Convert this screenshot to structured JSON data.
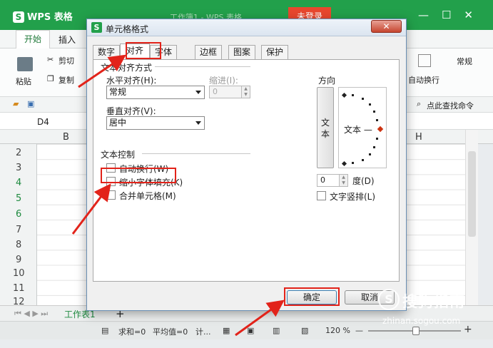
{
  "app": {
    "name": "WPS 表格",
    "doc_title": "工作簿1 - WPS 表格",
    "login_label": "未登录",
    "window_controls": [
      "—",
      "☐",
      "✕"
    ]
  },
  "ribbon": {
    "tabs": [
      "开始",
      "插入"
    ],
    "paste": "粘贴",
    "cut": "剪切",
    "copy": "复制",
    "wrap": "自动换行",
    "normal": "常规",
    "find": "点此查找命令"
  },
  "formula_bar": {
    "name_box": "D4"
  },
  "sheet": {
    "columns": [
      "B",
      "H"
    ],
    "rows": [
      "2",
      "3",
      "4",
      "5",
      "6",
      "7",
      "8",
      "9",
      "10",
      "11",
      "12"
    ],
    "tab": "工作表1",
    "add_tab": "+"
  },
  "status": {
    "sum": "求和=0",
    "avg": "平均值=0",
    "count": "计...",
    "zoom": "120 %",
    "zoom_minus": "—",
    "zoom_plus": "+"
  },
  "dialog": {
    "title": "单元格格式",
    "close": "✕",
    "tabs": [
      "数字",
      "对齐",
      "字体",
      "边框",
      "图案",
      "保护"
    ],
    "active_tab": "对齐",
    "text_align_section": "文本对齐方式",
    "h_align_label": "水平对齐(H):",
    "h_align_value": "常规",
    "indent_label": "缩进(I):",
    "indent_value": "0",
    "v_align_label": "垂直对齐(V):",
    "v_align_value": "居中",
    "text_control_section": "文本控制",
    "checkboxes": [
      {
        "label": "自动换行(W)",
        "checked": false
      },
      {
        "label": "缩小字体填充(K)",
        "checked": false
      },
      {
        "label": "合并单元格(M)",
        "checked": false
      }
    ],
    "orientation_section": "方向",
    "vertical_text": [
      "文",
      "本"
    ],
    "dial_text": "文本 —",
    "degree_value": "0",
    "degree_label": "度(D)",
    "vertical_stack_label": "文字竖排(L)",
    "ok": "确定",
    "cancel": "取消"
  },
  "watermark": {
    "name": "搜狗指南",
    "url": "zhinan.sogou.com"
  },
  "colors": {
    "brand_green": "#22a04b",
    "annotation_red": "#e2231a",
    "login_red": "#e8472e"
  }
}
